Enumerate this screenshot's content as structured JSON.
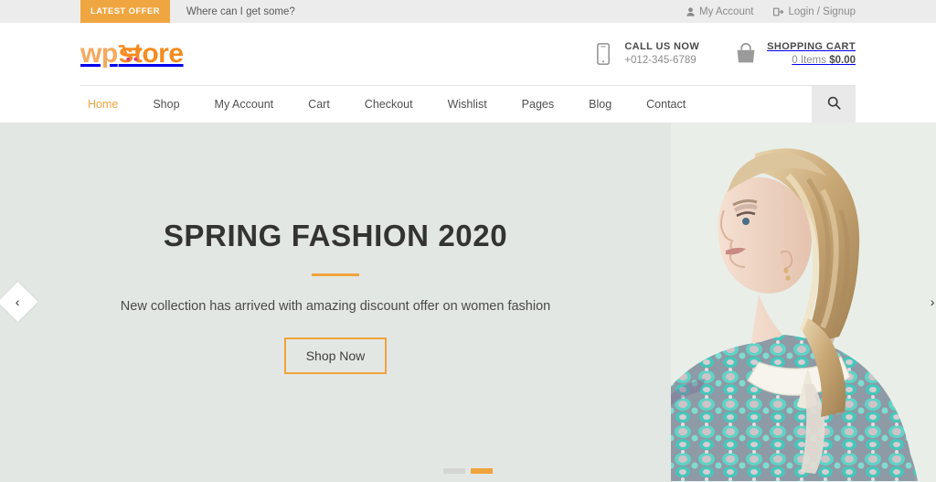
{
  "topbar": {
    "offer_badge": "LATEST OFFER",
    "offer_text": "Where can I get some?",
    "my_account": "My Account",
    "login_signup": "Login / Signup"
  },
  "header": {
    "logo_part1": "wp",
    "logo_part2": "store",
    "call": {
      "title": "CALL US NOW",
      "phone": "+012-345-6789"
    },
    "cart": {
      "title": "SHOPPING CART",
      "items": "0 Items",
      "amount": "$0.00"
    }
  },
  "nav": {
    "items": [
      {
        "label": "Home",
        "active": true
      },
      {
        "label": "Shop",
        "active": false
      },
      {
        "label": "My Account",
        "active": false
      },
      {
        "label": "Cart",
        "active": false
      },
      {
        "label": "Checkout",
        "active": false
      },
      {
        "label": "Wishlist",
        "active": false
      },
      {
        "label": "Pages",
        "active": false
      },
      {
        "label": "Blog",
        "active": false
      },
      {
        "label": "Contact",
        "active": false
      }
    ]
  },
  "hero": {
    "title": "SPRING FASHION 2020",
    "subtitle": "New collection has arrived with amazing discount offer on women fashion",
    "cta": "Shop Now",
    "prev_arrow": "‹",
    "next_arrow": "›",
    "slides": [
      {
        "active": false
      },
      {
        "active": true
      }
    ]
  },
  "colors": {
    "accent_orange": "#f0a23c",
    "logo_light": "#f5a95f",
    "logo_dark": "#f68b1f",
    "topbar_bg": "#ececec",
    "hero_bg": "#e3e7e3",
    "text_dark": "#333333",
    "text_muted": "#8a8a8a"
  }
}
